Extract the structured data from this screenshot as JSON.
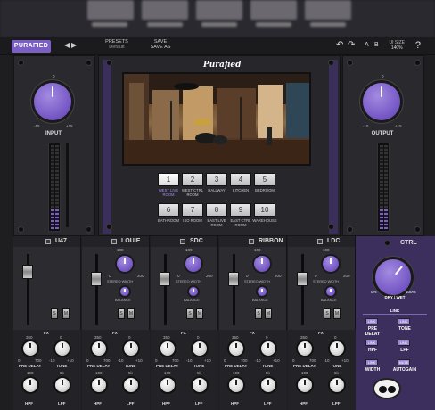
{
  "top_blur_tabs": [
    "",
    "",
    "",
    "",
    "",
    ""
  ],
  "toolbar": {
    "logo": "PURAFIED",
    "nav_left": "◀",
    "nav_right": "▶",
    "presets_label": "PRESETS",
    "presets_value": "Default",
    "save": "SAVE",
    "save_as": "SAVE AS",
    "undo": "↶",
    "redo": "↷",
    "a": "A",
    "b": "B",
    "ui_size_label": "UI SIZE",
    "ui_size_value": "140%",
    "help": "?"
  },
  "input": {
    "label": "INPUT",
    "top": "0",
    "min": "-15",
    "max": "+15"
  },
  "output": {
    "label": "OUTPUT",
    "top": "0",
    "min": "-15",
    "max": "+15"
  },
  "center": {
    "logo_text": "Purafied",
    "rooms_row1": [
      {
        "num": "1",
        "name": "WEST LIVE ROOM",
        "selected": true
      },
      {
        "num": "2",
        "name": "WEST CTRL ROOM",
        "selected": false
      },
      {
        "num": "3",
        "name": "HALLWAY",
        "selected": false
      },
      {
        "num": "4",
        "name": "KITCHEN",
        "selected": false
      },
      {
        "num": "5",
        "name": "BEDROOM",
        "selected": false
      }
    ],
    "rooms_row2": [
      {
        "num": "6",
        "name": "BATHROOM"
      },
      {
        "num": "7",
        "name": "ISO ROOM"
      },
      {
        "num": "8",
        "name": "EAST LIVE ROOM"
      },
      {
        "num": "9",
        "name": "EAST CTRL ROOM"
      },
      {
        "num": "10",
        "name": "WAREHOUSE"
      }
    ]
  },
  "strips": [
    {
      "name": "U47"
    },
    {
      "name": "LOUIE"
    },
    {
      "name": "SDC"
    },
    {
      "name": "RIBBON"
    },
    {
      "name": "LDC"
    }
  ],
  "strip_labels": {
    "width_top": "100",
    "width_min": "0",
    "width_max": "200",
    "stereo_width": "STEREO WIDTH",
    "balance": "BALANCE",
    "s": "S",
    "m": "M",
    "fx": "FX",
    "pre_delay": "PRE DELAY",
    "tone": "TONE",
    "hpf": "HPF",
    "lpf": "LPF",
    "pd_min": "0",
    "pd_max": "700",
    "pd_top": "350",
    "tone_min": "-10",
    "tone_max": "+10",
    "tone_top": "0",
    "hpf_top": "100",
    "lpf_top": "5k"
  },
  "ctrl": {
    "title": "CTRL",
    "mix_min": "0%",
    "mix_max": "100%",
    "mix_label": "DRY / WET",
    "link": "LINK",
    "link_btn": "LINK",
    "pre_delay": "PRE DELAY",
    "tone": "TONE",
    "hpf": "HPF",
    "lpf": "LPF",
    "width": "WIDTH",
    "autogain": "AUTOGAIN",
    "mute": "MUTE"
  }
}
